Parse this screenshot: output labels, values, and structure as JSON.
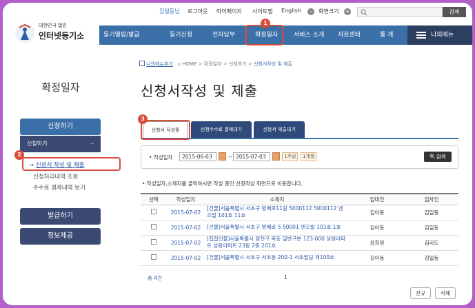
{
  "util": {
    "user": "김일동님",
    "logout": "로그아웃",
    "mypage": "마이페이지",
    "sitemap": "사이트맵",
    "english": "English",
    "zoom_label": "화면크기",
    "search_button": "검색"
  },
  "logo": {
    "top": "대한민국 법원",
    "main": "인터넷등기소"
  },
  "nav": {
    "items": [
      "등기열람/발급",
      "등기신청",
      "전자납부",
      "확정일자",
      "서비스 소개",
      "자료센터",
      "통 계"
    ],
    "my_menu": "나의메뉴"
  },
  "sidebar": {
    "title": "확정일자",
    "apply_btn": "신청하기",
    "sub_header": "신청하기",
    "sub_toggle": "–",
    "links": [
      "신청서 작성 및 제출",
      "신청처리내역 조회",
      "수수료 결제내역 보기"
    ],
    "issue_btn": "발급하기",
    "info_btn": "정보제공"
  },
  "breadcrumb": {
    "add_menu": "나의메뉴추가",
    "path": "HOME > 확정일자 > 신청하기 > ",
    "current": "신청서작성 및 제출"
  },
  "page_title": "신청서작성 및 제출",
  "tabs": [
    "신청서 작성중",
    "신청수수료 결제대기",
    "신청서 제출대기"
  ],
  "filter": {
    "label": "작성일자",
    "from": "2015-06-03",
    "sep": "~",
    "to": "2015-07-03",
    "week": "1주일",
    "month": "1개월",
    "search": "검색"
  },
  "note": "• 작성일자,소재지를 클릭하시면 작성 중인 신청작성 화면으로 이동합니다.",
  "table": {
    "headers": [
      "선택",
      "작성일자",
      "소재지",
      "임대인",
      "임차인"
    ],
    "rows": [
      {
        "date": "2015-07-02",
        "addr": "[건물]서울특별시 서초구 방배로11길 5000112 5000112 엔즈빌 101호 11호",
        "lessor": "김이동",
        "lessee": "김일동"
      },
      {
        "date": "2015-07-02",
        "addr": "[건물]서울특별시 서초구 방배로 5 50001 엔즈빌 101호 1호",
        "lessor": "김이동",
        "lessee": "김일동"
      },
      {
        "date": "2015-07-02",
        "addr": "[집합건물]서울특별시 양천구 목동 일반구분 123-000 성원아파트 성원아파트 23동 2층 201호",
        "lessor": "윤희원",
        "lessee": "김리도"
      },
      {
        "date": "2015-07-02",
        "addr": "[건물]서울특별시 서초구 서초동 200-1 서초빌딩 제100호",
        "lessor": "김이동",
        "lessee": "김일동"
      }
    ]
  },
  "total": "총 4건",
  "page_number": "1",
  "buttons": {
    "new": "신규",
    "delete": "삭제"
  },
  "badges": [
    "1",
    "2",
    "3"
  ],
  "colors": {
    "nav": "#3b6fa8",
    "highlight": "#d94c3a",
    "frame": "#b060c8"
  }
}
